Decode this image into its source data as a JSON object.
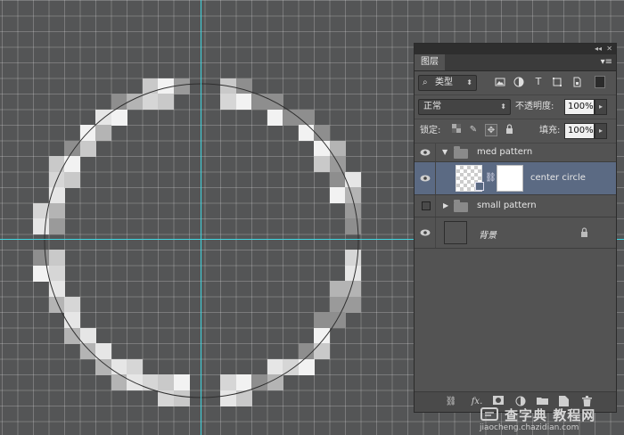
{
  "panel": {
    "tab_label": "图层",
    "collapse_glyph": "◂◂",
    "close_glyph": "✕",
    "menu_glyph": "▾≡"
  },
  "filter": {
    "kind_label": "类型",
    "search_glyph": "⌕",
    "icons": [
      "image-filter-icon",
      "adjustment-filter-icon",
      "type-filter-icon",
      "shape-filter-icon",
      "smart-object-filter-icon"
    ],
    "type_glyph": "T"
  },
  "blend": {
    "mode": "正常",
    "opacity_label": "不透明度:",
    "opacity_value": "100%"
  },
  "lock": {
    "label": "锁定:",
    "fill_label": "填充:",
    "fill_value": "100%"
  },
  "layers": [
    {
      "name": "med pattern",
      "type": "group",
      "expanded": true,
      "visible": true
    },
    {
      "name": "center circle",
      "type": "layer",
      "selected": true,
      "visible": true
    },
    {
      "name": "small pattern",
      "type": "group",
      "expanded": false,
      "visible": false
    },
    {
      "name": "背景",
      "type": "background",
      "visible": true,
      "locked": true
    }
  ],
  "footer_icons": [
    "link-layers-icon",
    "fx-icon",
    "add-mask-icon",
    "adjustment-layer-icon",
    "new-group-icon",
    "new-layer-icon",
    "trash-icon"
  ],
  "fx_label": "fx.",
  "watermark": {
    "main": "查字典 教程网",
    "sub": "jiaocheng.chazidian.com"
  },
  "colors": {
    "canvas_bg": "#545556",
    "guide": "#3fd6e0",
    "selected_row": "#5b6a83",
    "panel_bg": "#535353"
  }
}
